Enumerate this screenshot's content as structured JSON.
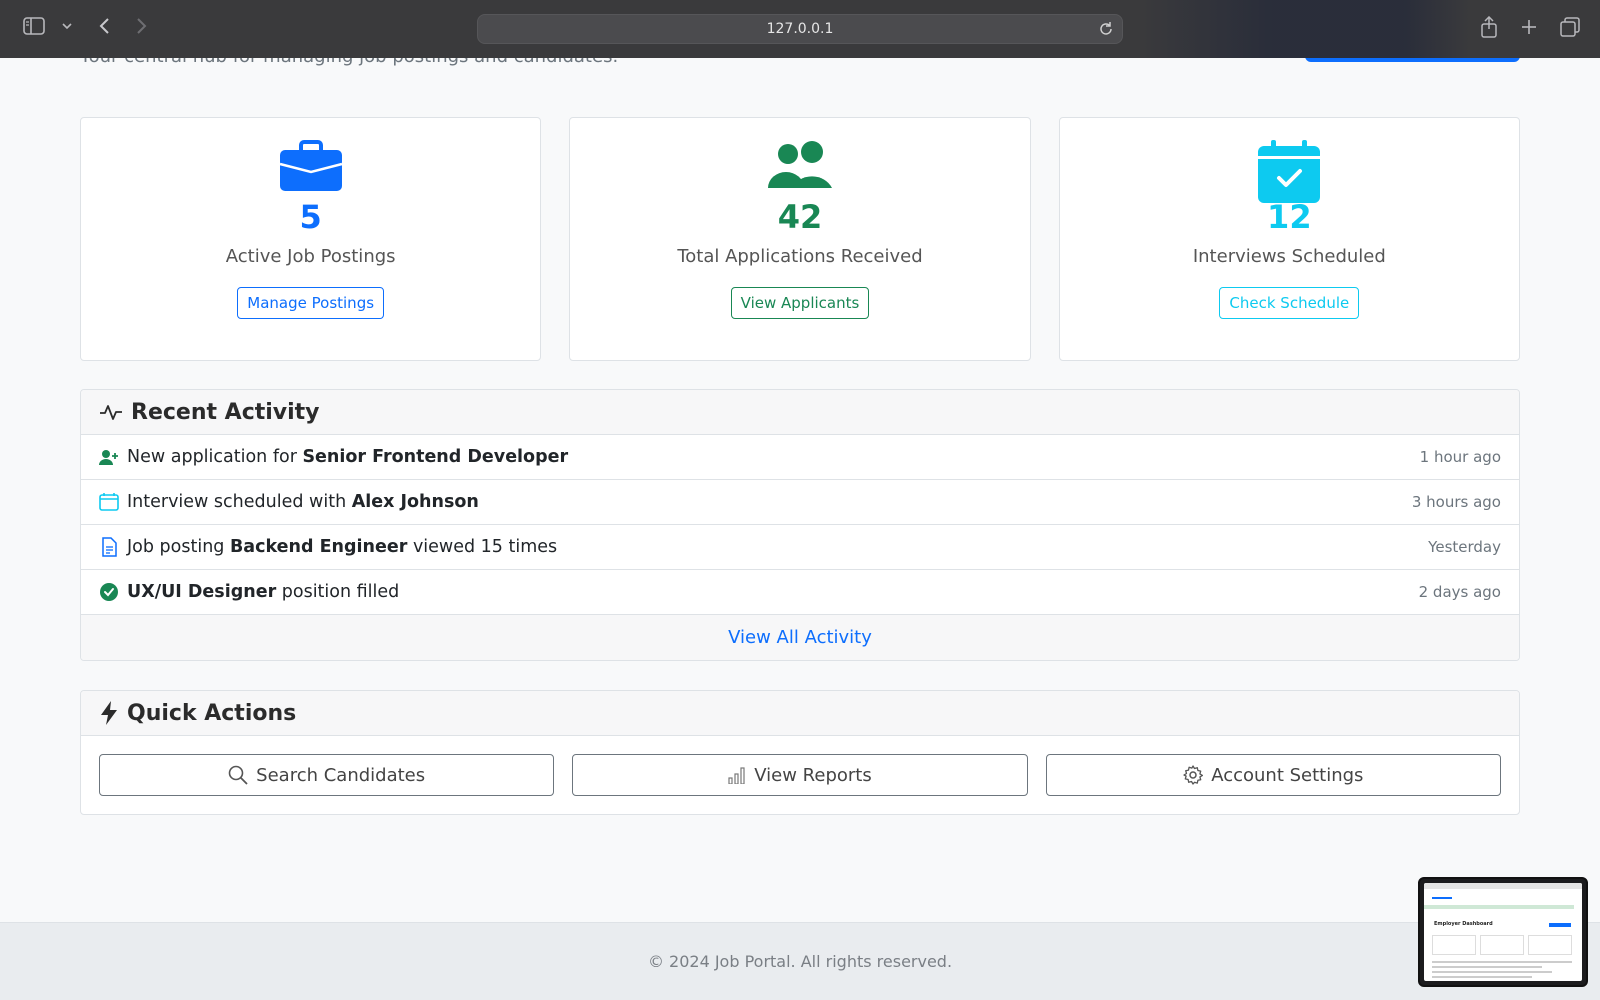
{
  "browser": {
    "url": "127.0.0.1"
  },
  "header": {
    "subtitle": "Your central hub for managing job postings and candidates."
  },
  "stats": [
    {
      "value": "5",
      "label": "Active Job Postings",
      "button": "Manage Postings",
      "color": "#0d6efd",
      "icon": "briefcase-icon"
    },
    {
      "value": "42",
      "label": "Total Applications Received",
      "button": "View Applicants",
      "color": "#198754",
      "icon": "people-icon"
    },
    {
      "value": "12",
      "label": "Interviews Scheduled",
      "button": "Check Schedule",
      "color": "#0dcaf0",
      "icon": "calendar-check-icon"
    }
  ],
  "activity": {
    "title": "Recent Activity",
    "items": [
      {
        "icon": "person-plus-icon",
        "pre": "New application for ",
        "bold": "Senior Frontend Developer",
        "post": "",
        "time": "1 hour ago"
      },
      {
        "icon": "calendar-icon",
        "pre": "Interview scheduled with ",
        "bold": "Alex Johnson",
        "post": "",
        "time": "3 hours ago"
      },
      {
        "icon": "document-icon",
        "pre": "Job posting ",
        "bold": "Backend Engineer",
        "post": " viewed 15 times",
        "time": "Yesterday"
      },
      {
        "icon": "check-circle-icon",
        "pre": "",
        "bold": "UX/UI Designer",
        "post": " position filled",
        "time": "2 days ago"
      }
    ],
    "view_all": "View All Activity"
  },
  "quick_actions": {
    "title": "Quick Actions",
    "search": "Search Candidates",
    "reports": "View Reports",
    "settings": "Account Settings"
  },
  "footer": {
    "text": "© 2024 Job Portal. All rights reserved."
  },
  "thumbnail": {
    "title": "Employer Dashboard"
  }
}
